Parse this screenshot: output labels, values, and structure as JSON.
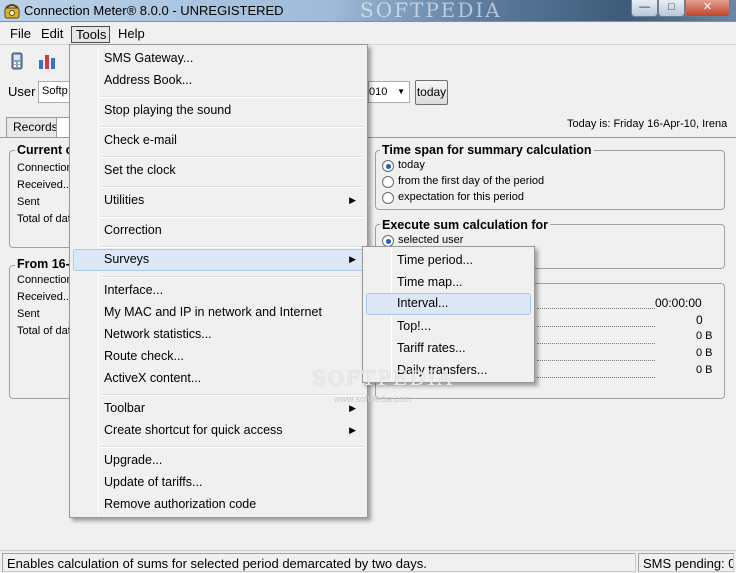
{
  "window": {
    "title": "Connection Meter® 8.0.0 - UNREGISTERED",
    "controls": {
      "minimize": "—",
      "maximize": "□",
      "close": "✕"
    }
  },
  "watermark": "SOFTPEDIA",
  "watermark_small": "www.softpedia.com",
  "menubar": [
    {
      "label": "File"
    },
    {
      "label": "Edit"
    },
    {
      "label": "Tools"
    },
    {
      "label": "Help"
    }
  ],
  "user_row": {
    "label": "User",
    "user_value": "Softp",
    "date_value": "010",
    "today_button": "today"
  },
  "tabs": {
    "records": "Records"
  },
  "today_is": "Today is: Friday 16-Apr-10, Irena",
  "left_panel": {
    "current": {
      "title": "Current c",
      "rows": [
        "Connection",
        "Received..",
        "Sent",
        "Total of dat"
      ]
    },
    "from": {
      "title": "From 16-",
      "rows": [
        "Connection",
        "Received..",
        "Sent",
        "Total of dat"
      ]
    }
  },
  "time_span": {
    "title": "Time span for summary calculation",
    "options": [
      {
        "label": "today",
        "selected": true
      },
      {
        "label": "from the first day of the period",
        "selected": false
      },
      {
        "label": "expectation for this period",
        "selected": false
      }
    ]
  },
  "execute_sum": {
    "title": "Execute sum calculation for",
    "options": [
      {
        "label": "selected user",
        "selected": true
      }
    ]
  },
  "summary_values": {
    "time": "00:00:00",
    "count": "0",
    "received": "0 B",
    "sent": "0 B",
    "total": "0 B"
  },
  "tools_menu": {
    "items": [
      "SMS Gateway...",
      "Address Book...",
      "Stop playing the sound",
      "Check e-mail",
      "Set the clock",
      "Utilities",
      "Correction",
      "Surveys",
      "Interface...",
      "My MAC and IP in network and Internet",
      "Network statistics...",
      "Route check...",
      "ActiveX content...",
      "Toolbar",
      "Create shortcut for quick access",
      "Upgrade...",
      "Update of tariffs...",
      "Remove authorization code"
    ]
  },
  "surveys_submenu": {
    "items": [
      "Time period...",
      "Time map...",
      "Interval...",
      "Top!...",
      "Tariff rates...",
      "Daily transfers..."
    ]
  },
  "statusbar": {
    "message": "Enables calculation of sums for selected period demarcated by two days.",
    "sms": "SMS pending: 0"
  },
  "colors": {
    "menu_highlight": "#dce8f6",
    "menu_highlight_border": "#a9c8ec",
    "radio_dot": "#1d5fb8"
  },
  "icons": [
    "phone-app-icon",
    "phone-tool-icon",
    "bar-chart-icon",
    "submenu-arrow-icon",
    "dropdown-arrow-icon"
  ]
}
